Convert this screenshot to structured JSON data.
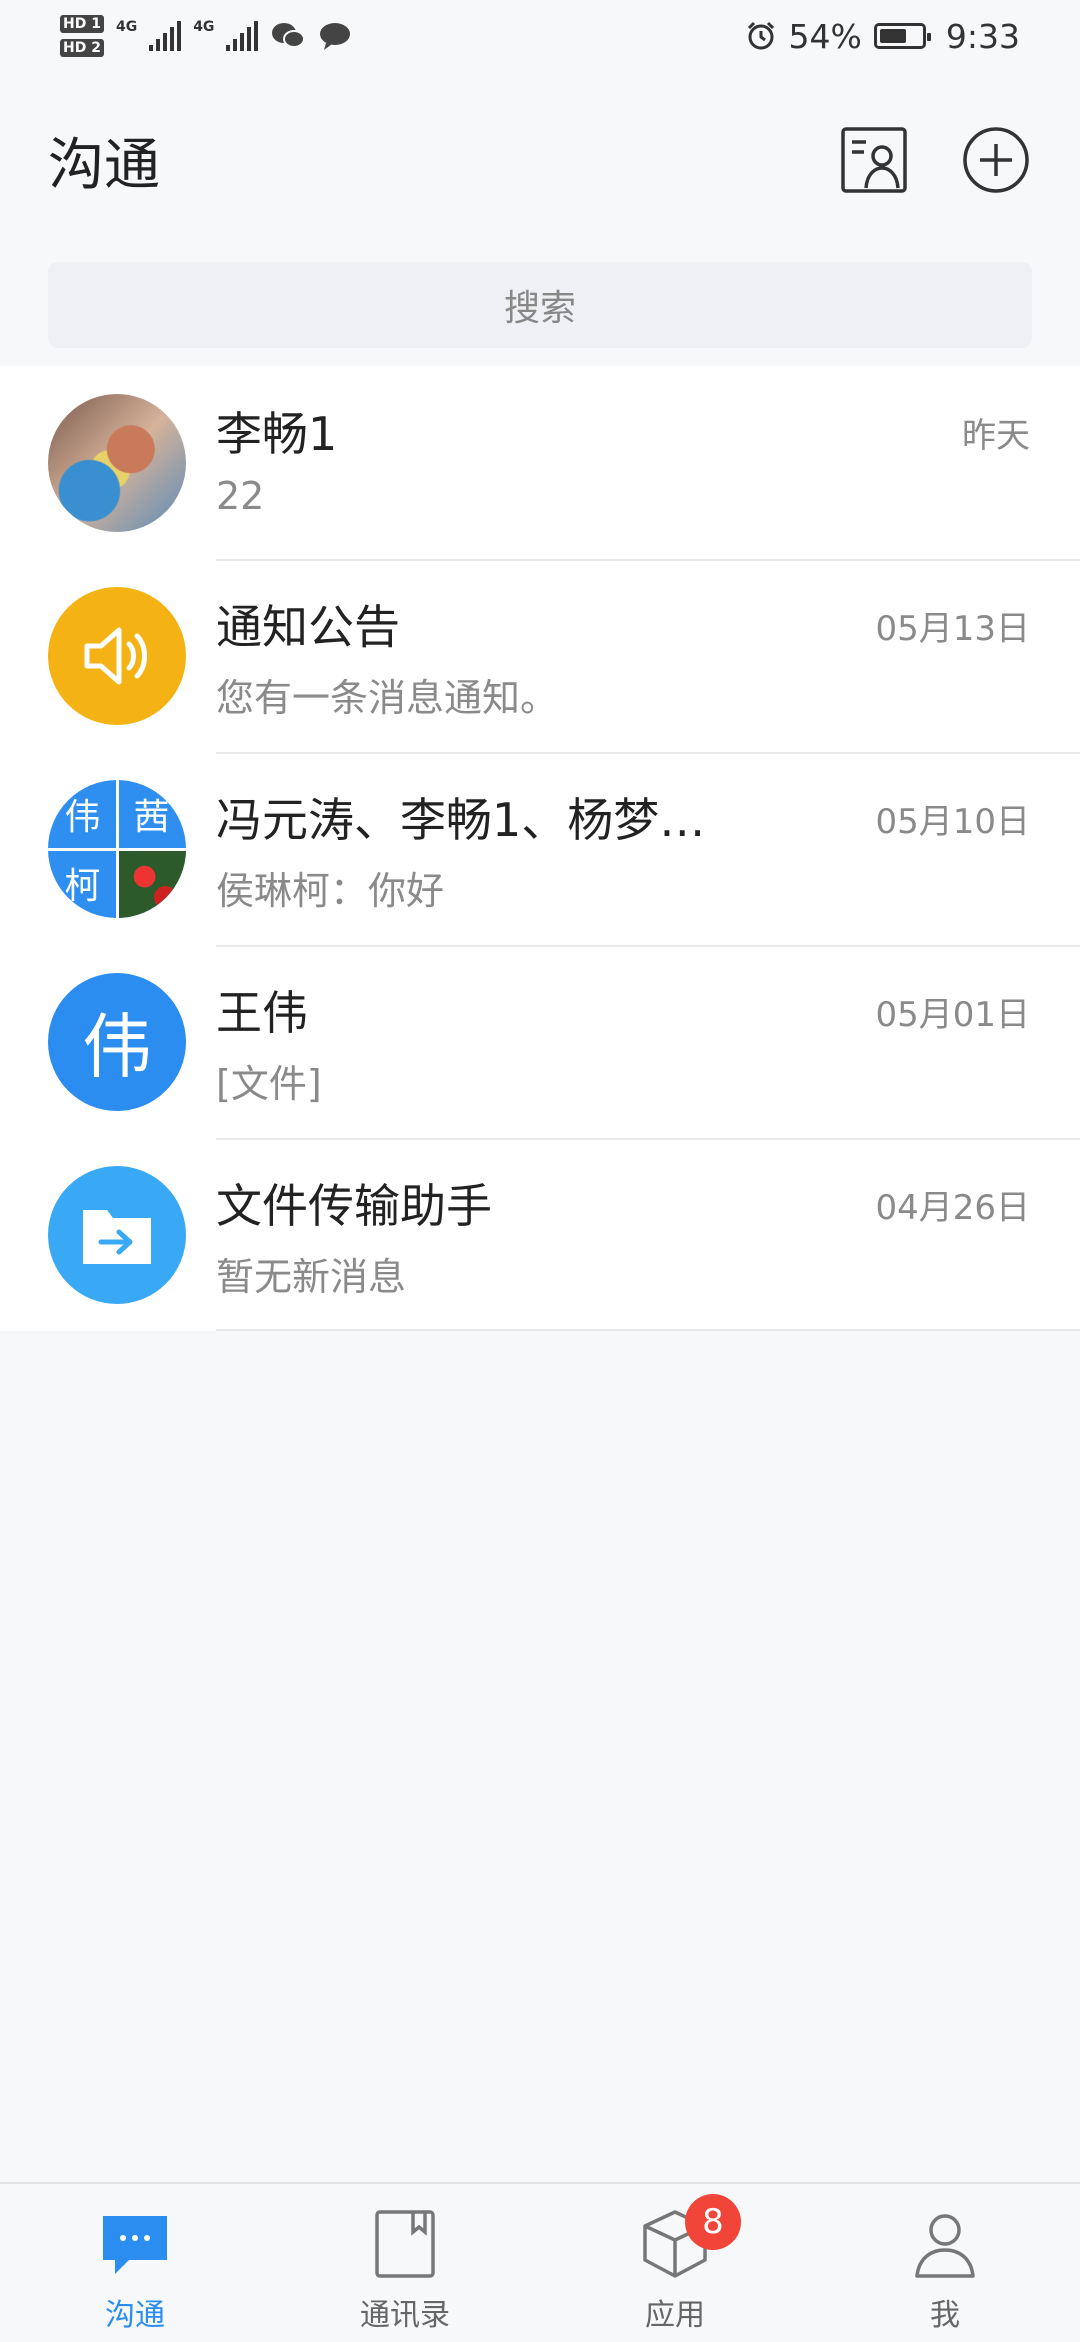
{
  "statusbar": {
    "sim1": "HD 1",
    "sim2": "HD 2",
    "net1": "4G",
    "net2": "4G",
    "battery": "54%",
    "time": "9:33",
    "icons": [
      "wechat-icon",
      "message-icon",
      "alarm-icon"
    ]
  },
  "header": {
    "title": "沟通",
    "icons": [
      "contact-card-icon",
      "add-circle-icon"
    ]
  },
  "search": {
    "placeholder": "搜索"
  },
  "conversations": [
    {
      "title": "李畅1",
      "subtitle": "22",
      "time": "昨天",
      "avatar": "photo"
    },
    {
      "title": "通知公告",
      "subtitle": "您有一条消息通知。",
      "time": "05月13日",
      "avatar": "speaker-icon",
      "avatar_color": "#f5b215"
    },
    {
      "title": "冯元涛、李畅1、杨梦…",
      "subtitle": "侯琳柯：你好",
      "time": "05月10日",
      "avatar": "group",
      "avatar_chars": [
        "伟",
        "茜",
        "柯"
      ],
      "avatar_color": "#2f8ff0"
    },
    {
      "title": "王伟",
      "subtitle": "[文件]",
      "time": "05月01日",
      "avatar_text": "伟",
      "avatar_color": "#2b8df0"
    },
    {
      "title": "文件传输助手",
      "subtitle": "暂无新消息",
      "time": "04月26日",
      "avatar": "folder-arrow-icon",
      "avatar_color": "#3aa9f5"
    }
  ],
  "tabbar": {
    "tabs": [
      {
        "label": "沟通",
        "icon": "chat-bubble-icon",
        "active": true
      },
      {
        "label": "通讯录",
        "icon": "address-book-icon"
      },
      {
        "label": "应用",
        "icon": "box-icon",
        "badge": "8"
      },
      {
        "label": "我",
        "icon": "person-icon"
      }
    ]
  },
  "colors": {
    "accent": "#2b8df0",
    "badge": "#f04538",
    "background": "#f7f8fa"
  }
}
